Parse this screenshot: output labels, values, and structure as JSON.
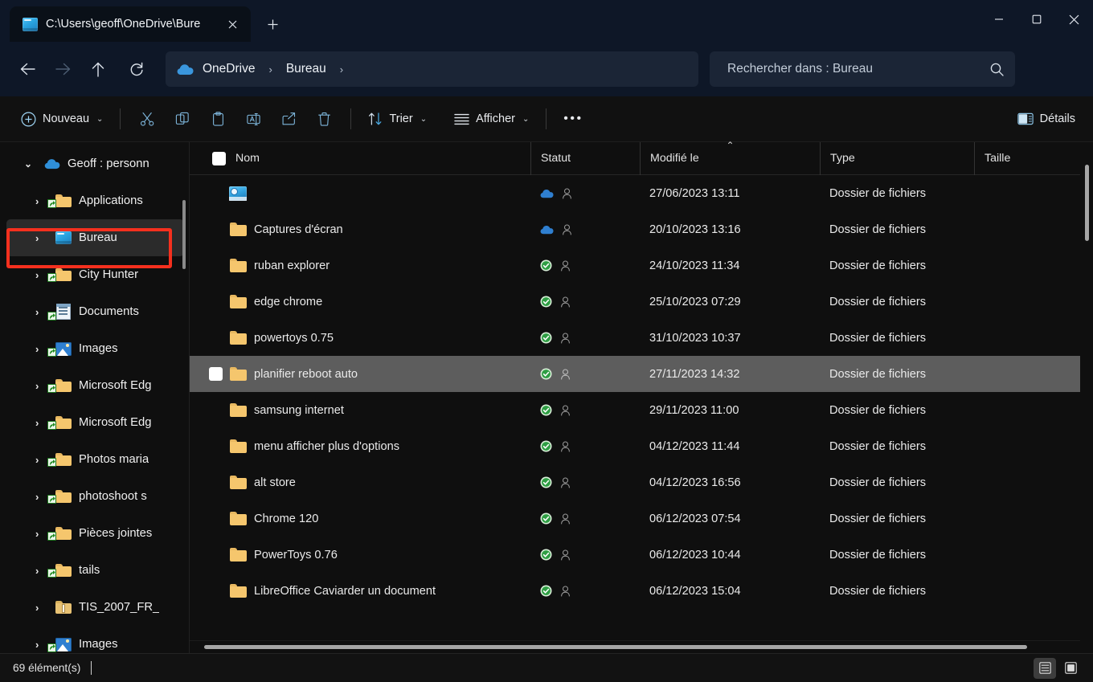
{
  "window": {
    "tab_title": "C:\\Users\\geoff\\OneDrive\\Bure",
    "tab_close_label": "✕",
    "new_tab_label": "+",
    "minimize_label": "Réduire",
    "maximize_label": "Agrandir",
    "close_label": "Fermer"
  },
  "nav": {
    "back_label": "Précédent",
    "forward_label": "Suivant",
    "up_label": "Remonter d'un niveau",
    "refresh_label": "Actualiser",
    "breadcrumbs": [
      {
        "label": "OneDrive",
        "icon": "cloud-icon"
      },
      {
        "label": "Bureau",
        "icon": ""
      }
    ],
    "separator": "›"
  },
  "search": {
    "placeholder": "Rechercher dans : Bureau",
    "value": "",
    "icon": "search-icon"
  },
  "toolbar": {
    "new_label": "Nouveau",
    "cut_label": "Couper",
    "copy_label": "Copier",
    "paste_label": "Coller",
    "rename_label": "Renommer",
    "share_label": "Partager",
    "delete_label": "Supprimer",
    "sort_label": "Trier",
    "view_label": "Afficher",
    "more_label": "•••",
    "details_label": "Détails",
    "chevron": "⌄"
  },
  "sidebar": {
    "items": [
      {
        "label": "Geoff : personn",
        "icon": "onedrive-cloud-icon",
        "expanded": true,
        "level": 0,
        "chevron": "⌄",
        "shortcut": false
      },
      {
        "label": "Applications",
        "icon": "folder-icon",
        "expanded": false,
        "level": 1,
        "chevron": "›",
        "shortcut": true
      },
      {
        "label": "Bureau",
        "icon": "desktop-icon",
        "expanded": false,
        "level": 1,
        "chevron": "›",
        "shortcut": false,
        "selected": true
      },
      {
        "label": "City Hunter",
        "icon": "folder-icon",
        "expanded": false,
        "level": 1,
        "chevron": "›",
        "shortcut": true
      },
      {
        "label": "Documents",
        "icon": "documents-icon",
        "expanded": false,
        "level": 1,
        "chevron": "›",
        "shortcut": true
      },
      {
        "label": "Images",
        "icon": "pictures-icon",
        "expanded": false,
        "level": 1,
        "chevron": "›",
        "shortcut": true
      },
      {
        "label": "Microsoft Edg",
        "icon": "folder-icon",
        "expanded": false,
        "level": 1,
        "chevron": "›",
        "shortcut": true
      },
      {
        "label": "Microsoft Edg",
        "icon": "folder-icon",
        "expanded": false,
        "level": 1,
        "chevron": "›",
        "shortcut": true
      },
      {
        "label": "Photos maria",
        "icon": "folder-icon",
        "expanded": false,
        "level": 1,
        "chevron": "›",
        "shortcut": true
      },
      {
        "label": "photoshoot s",
        "icon": "folder-icon",
        "expanded": false,
        "level": 1,
        "chevron": "›",
        "shortcut": true
      },
      {
        "label": "Pièces jointes",
        "icon": "folder-icon",
        "expanded": false,
        "level": 1,
        "chevron": "›",
        "shortcut": true
      },
      {
        "label": "tails",
        "icon": "folder-icon",
        "expanded": false,
        "level": 1,
        "chevron": "›",
        "shortcut": true
      },
      {
        "label": "TIS_2007_FR_",
        "icon": "zip-folder-icon",
        "expanded": false,
        "level": 1,
        "chevron": "›",
        "shortcut": false
      },
      {
        "label": "Images",
        "icon": "pictures-icon",
        "expanded": false,
        "level": 1,
        "chevron": "›",
        "shortcut": true
      }
    ]
  },
  "filelist": {
    "columns": [
      {
        "key": "name",
        "label": "Nom",
        "sorted": false
      },
      {
        "key": "status",
        "label": "Statut",
        "sorted": false
      },
      {
        "key": "modified",
        "label": "Modifié le",
        "sorted": true,
        "sort_dir": "asc",
        "sort_glyph": "⌃"
      },
      {
        "key": "type",
        "label": "Type",
        "sorted": false
      },
      {
        "key": "size",
        "label": "Taille",
        "sorted": false
      }
    ],
    "rows": [
      {
        "name": "",
        "icon": "special-folder-icon",
        "status": "cloud-only",
        "modified": "27/06/2023 13:11",
        "type": "Dossier de fichiers",
        "size": "",
        "selected": false
      },
      {
        "name": "Captures d'écran",
        "icon": "folder-icon",
        "status": "cloud-only",
        "modified": "20/10/2023 13:16",
        "type": "Dossier de fichiers",
        "size": "",
        "selected": false
      },
      {
        "name": "ruban explorer",
        "icon": "folder-icon",
        "status": "synced",
        "modified": "24/10/2023 11:34",
        "type": "Dossier de fichiers",
        "size": "",
        "selected": false
      },
      {
        "name": "edge chrome",
        "icon": "folder-icon",
        "status": "synced",
        "modified": "25/10/2023 07:29",
        "type": "Dossier de fichiers",
        "size": "",
        "selected": false
      },
      {
        "name": "powertoys 0.75",
        "icon": "folder-icon",
        "status": "synced",
        "modified": "31/10/2023 10:37",
        "type": "Dossier de fichiers",
        "size": "",
        "selected": false
      },
      {
        "name": "planifier reboot auto",
        "icon": "folder-icon",
        "status": "synced",
        "modified": "27/11/2023 14:32",
        "type": "Dossier de fichiers",
        "size": "",
        "selected": true
      },
      {
        "name": "samsung internet",
        "icon": "folder-icon",
        "status": "synced",
        "modified": "29/11/2023 11:00",
        "type": "Dossier de fichiers",
        "size": "",
        "selected": false
      },
      {
        "name": "menu afficher plus d'options",
        "icon": "folder-icon",
        "status": "synced",
        "modified": "04/12/2023 11:44",
        "type": "Dossier de fichiers",
        "size": "",
        "selected": false
      },
      {
        "name": "alt store",
        "icon": "folder-icon",
        "status": "synced",
        "modified": "04/12/2023 16:56",
        "type": "Dossier de fichiers",
        "size": "",
        "selected": false
      },
      {
        "name": "Chrome 120",
        "icon": "folder-icon",
        "status": "synced",
        "modified": "06/12/2023 07:54",
        "type": "Dossier de fichiers",
        "size": "",
        "selected": false
      },
      {
        "name": "PowerToys 0.76",
        "icon": "folder-icon",
        "status": "synced",
        "modified": "06/12/2023 10:44",
        "type": "Dossier de fichiers",
        "size": "",
        "selected": false
      },
      {
        "name": "LibreOffice Caviarder un document",
        "icon": "folder-icon",
        "status": "synced",
        "modified": "06/12/2023 15:04",
        "type": "Dossier de fichiers",
        "size": "",
        "selected": false
      }
    ]
  },
  "statusbar": {
    "count_text": "69 élément(s)",
    "details_view_label": "Détails",
    "large_icons_view_label": "Grandes icônes"
  },
  "colors": {
    "accent_blue": "#4fc3f7",
    "titlebar_bg": "#0e1727",
    "tab_bg": "#0a1018",
    "content_bg": "#0f0f0f",
    "selected_row": "#5d5d5d",
    "sidebar_selected": "#2b2b2b",
    "annotation_red": "#f5301e",
    "sync_green": "#3fb950",
    "cloud_blue": "#2f7fd0"
  }
}
